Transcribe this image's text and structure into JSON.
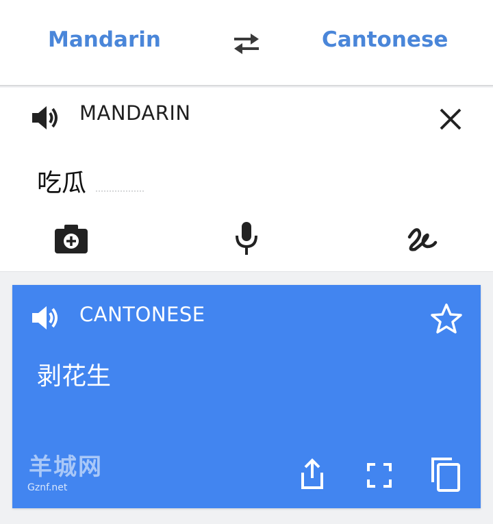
{
  "language_bar": {
    "source_language": "Mandarin",
    "target_language": "Cantonese",
    "swap_icon": "swap-arrows-icon"
  },
  "input_card": {
    "language_label": "MANDARIN",
    "text": "吃瓜",
    "icons": [
      "speaker-icon",
      "close-icon",
      "camera-icon",
      "microphone-icon",
      "handwriting-icon"
    ]
  },
  "output_card": {
    "language_label": "CANTONESE",
    "text": "剥花生",
    "background_color": "#4285f0",
    "icons": [
      "speaker-icon",
      "star-icon",
      "share-icon",
      "fullscreen-icon",
      "copy-icon"
    ]
  },
  "watermark": {
    "logo": "羊城网",
    "site": "Gznf.net"
  },
  "colors": {
    "accent": "#4a86d9",
    "output_card": "#4285f0"
  }
}
